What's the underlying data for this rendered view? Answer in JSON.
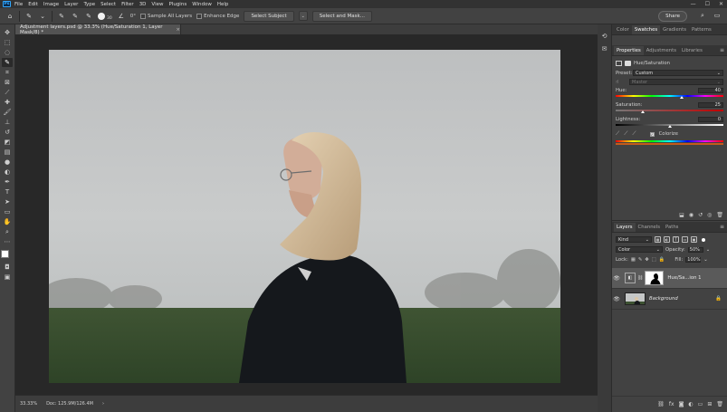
{
  "menubar": {
    "logo": "Ps",
    "items": [
      "File",
      "Edit",
      "Image",
      "Layer",
      "Type",
      "Select",
      "Filter",
      "3D",
      "View",
      "Plugins",
      "Window",
      "Help"
    ],
    "window_controls": [
      "—",
      "☐",
      "✕"
    ]
  },
  "options": {
    "brush_size": "30",
    "angle": "0°",
    "sample_all_layers": "Sample All Layers",
    "enhance_edge": "Enhance Edge",
    "select_subject": "Select Subject",
    "select_and_mask": "Select and Mask...",
    "share": "Share"
  },
  "document": {
    "tab_title": "Adjustment layers.psd @ 33.3% (Hue/Saturation 1, Layer Mask/8) *",
    "close": "×"
  },
  "status": {
    "zoom": "33.33%",
    "doc_size": "Doc: 125.9M/126.4M",
    "arrow": "›"
  },
  "top_panel": {
    "tabs": [
      "Color",
      "Swatches",
      "Gradients",
      "Patterns"
    ]
  },
  "properties": {
    "tabs": [
      "Properties",
      "Adjustments",
      "Libraries"
    ],
    "title": "Hue/Saturation",
    "preset_label": "Preset:",
    "preset_value": "Custom",
    "range_value": "Master",
    "hue_label": "Hue:",
    "hue_value": "40",
    "hue_position": 0.61,
    "saturation_label": "Saturation:",
    "saturation_value": "25",
    "saturation_position": 0.25,
    "lightness_label": "Lightness:",
    "lightness_value": "0",
    "lightness_position": 0.5,
    "colorize_label": "Colorize",
    "colorize_checked": "✓"
  },
  "layers": {
    "tabs": [
      "Layers",
      "Channels",
      "Paths"
    ],
    "kind_label": "Kind",
    "blend_mode": "Color",
    "opacity_label": "Opacity:",
    "opacity_value": "50%",
    "lock_label": "Lock:",
    "fill_label": "Fill:",
    "fill_value": "100%",
    "items": [
      {
        "name": "Hue/Sa...ion 1"
      },
      {
        "name": "Background"
      }
    ]
  }
}
